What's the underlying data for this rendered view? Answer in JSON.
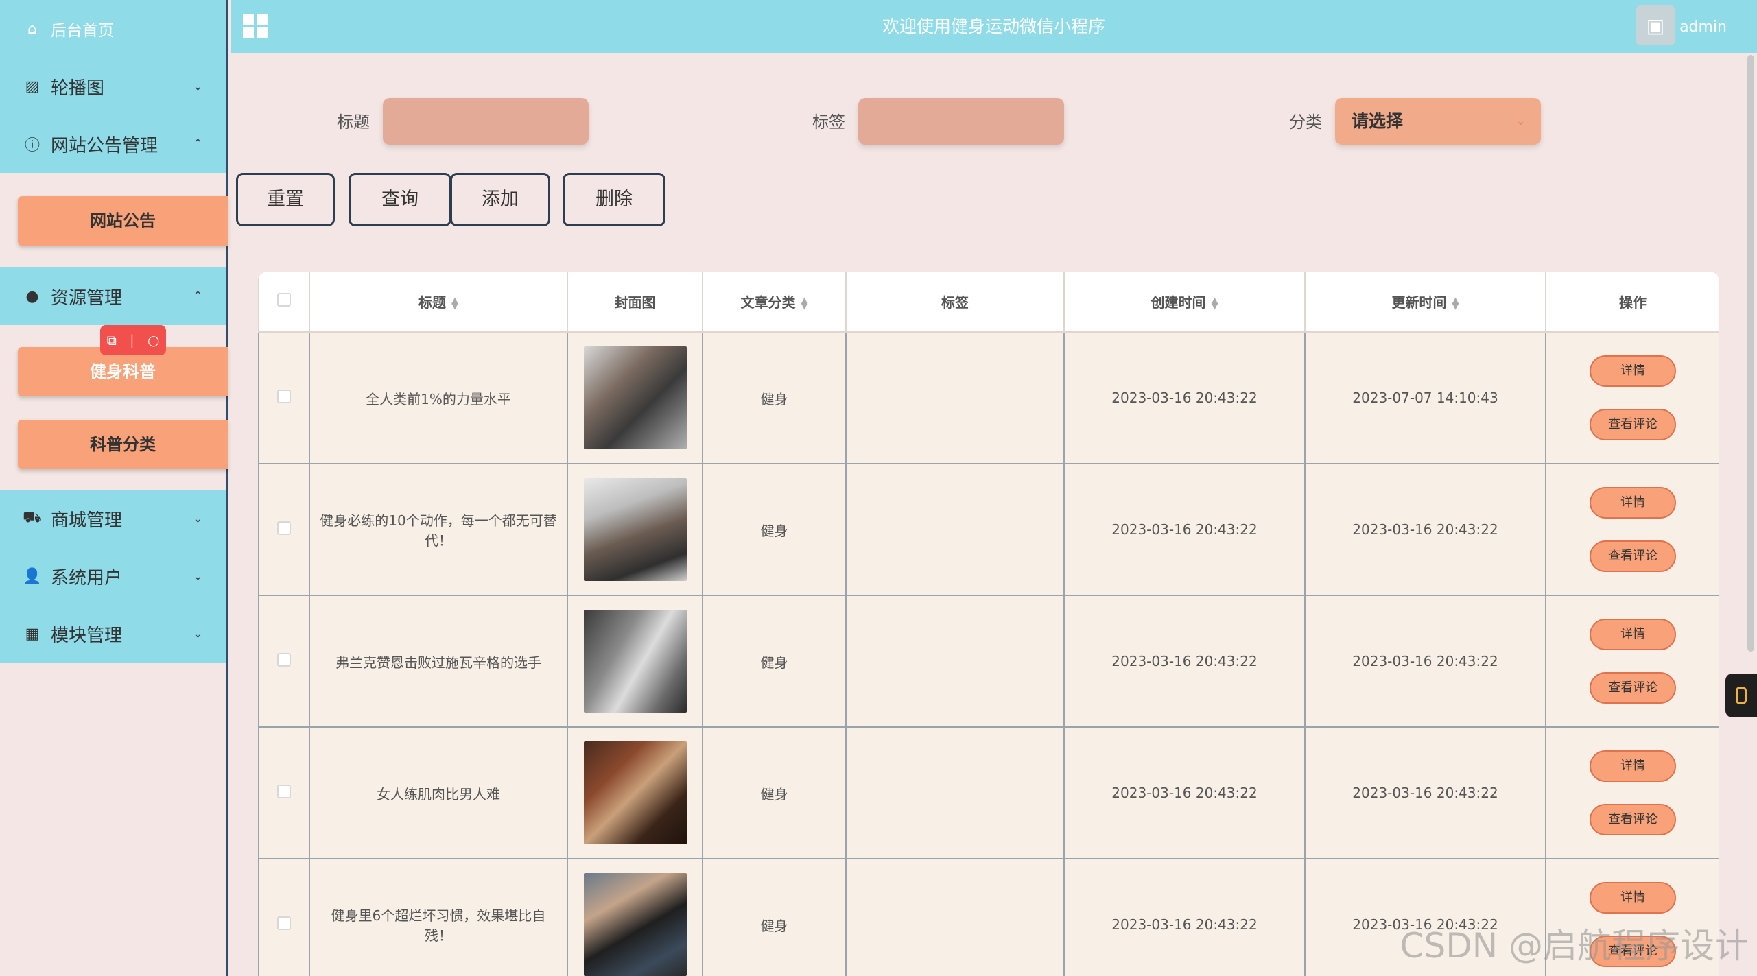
{
  "sidebar": {
    "home": "后台首页",
    "carousel": "轮播图",
    "notice_mgmt": "网站公告管理",
    "notice_item": "网站公告",
    "resource_mgmt": "资源管理",
    "resource_items": [
      "健身科普",
      "科普分类"
    ],
    "mall_mgmt": "商城管理",
    "sys_user": "系统用户",
    "module_mgmt": "模块管理"
  },
  "float_tool": {
    "left_icon": "ocr-icon",
    "right_icon": "search-icon"
  },
  "topbar": {
    "title": "欢迎使用健身运动微信小程序",
    "user": "admin"
  },
  "search": {
    "title_label": "标题",
    "tag_label": "标签",
    "category_label": "分类",
    "category_value": "请选择"
  },
  "buttons": {
    "reset": "重置",
    "query": "查询",
    "add": "添加",
    "delete": "删除"
  },
  "table": {
    "headers": [
      "标题",
      "封面图",
      "文章分类",
      "标签",
      "创建时间",
      "更新时间",
      "操作"
    ],
    "op_detail": "详情",
    "op_comments": "查看评论",
    "rows": [
      {
        "title": "全人类前1%的力量水平",
        "category": "健身",
        "tag": "",
        "created": "2023-03-16 20:43:22",
        "updated": "2023-07-07 14:10:43"
      },
      {
        "title": "健身必练的10个动作，每一个都无可替代！",
        "category": "健身",
        "tag": "",
        "created": "2023-03-16 20:43:22",
        "updated": "2023-03-16 20:43:22"
      },
      {
        "title": "弗兰克赞恩击败过施瓦辛格的选手",
        "category": "健身",
        "tag": "",
        "created": "2023-03-16 20:43:22",
        "updated": "2023-03-16 20:43:22"
      },
      {
        "title": "女人练肌肉比男人难",
        "category": "健身",
        "tag": "",
        "created": "2023-03-16 20:43:22",
        "updated": "2023-03-16 20:43:22"
      },
      {
        "title": "健身里6个超烂坏习惯，效果堪比自残！",
        "category": "健身",
        "tag": "",
        "created": "2023-03-16 20:43:22",
        "updated": "2023-03-16 20:43:22"
      }
    ]
  },
  "watermark": "CSDN @启航程序设计",
  "colors": {
    "accent_cyan": "#8fdbe7",
    "accent_orange": "#f9a27a",
    "bg": "#f3e6e4"
  }
}
